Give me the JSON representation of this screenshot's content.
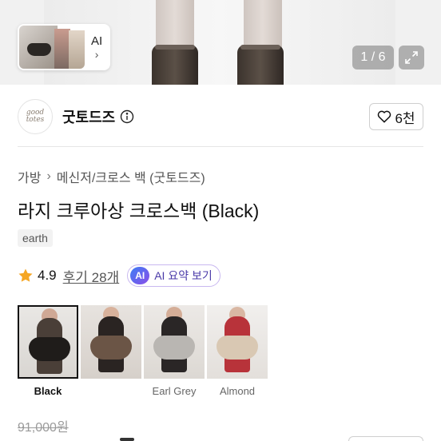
{
  "hero": {
    "ai_thumb_label": "AI",
    "ai_thumb_chevron": "›",
    "counter": "1 / 6",
    "expand_icon": "expand-icon"
  },
  "seller": {
    "logo_text": "good totes",
    "name": "굿토드즈",
    "info_icon": "info-icon",
    "like_count": "6천"
  },
  "breadcrumb": [
    "가방",
    "메신저/크로스 백 (굿토드즈)"
  ],
  "breadcrumb_sep": "›",
  "product": {
    "title": "라지 크루아상 크로스백 (Black)",
    "tag": "earth"
  },
  "rating": {
    "value": "4.9",
    "reviews": "후기 28개",
    "ai_badge": "AI",
    "ai_summary": "AI 요약 보기"
  },
  "variants": [
    {
      "name": "Black",
      "selected": true
    },
    {
      "name": "",
      "selected": false
    },
    {
      "name": "Earl Grey",
      "selected": false
    },
    {
      "name": "Almond",
      "selected": false
    }
  ],
  "price": {
    "original": "91,000원"
  },
  "colors": {
    "ai_accent": "#4a3aa8",
    "star": "#f5a623"
  }
}
